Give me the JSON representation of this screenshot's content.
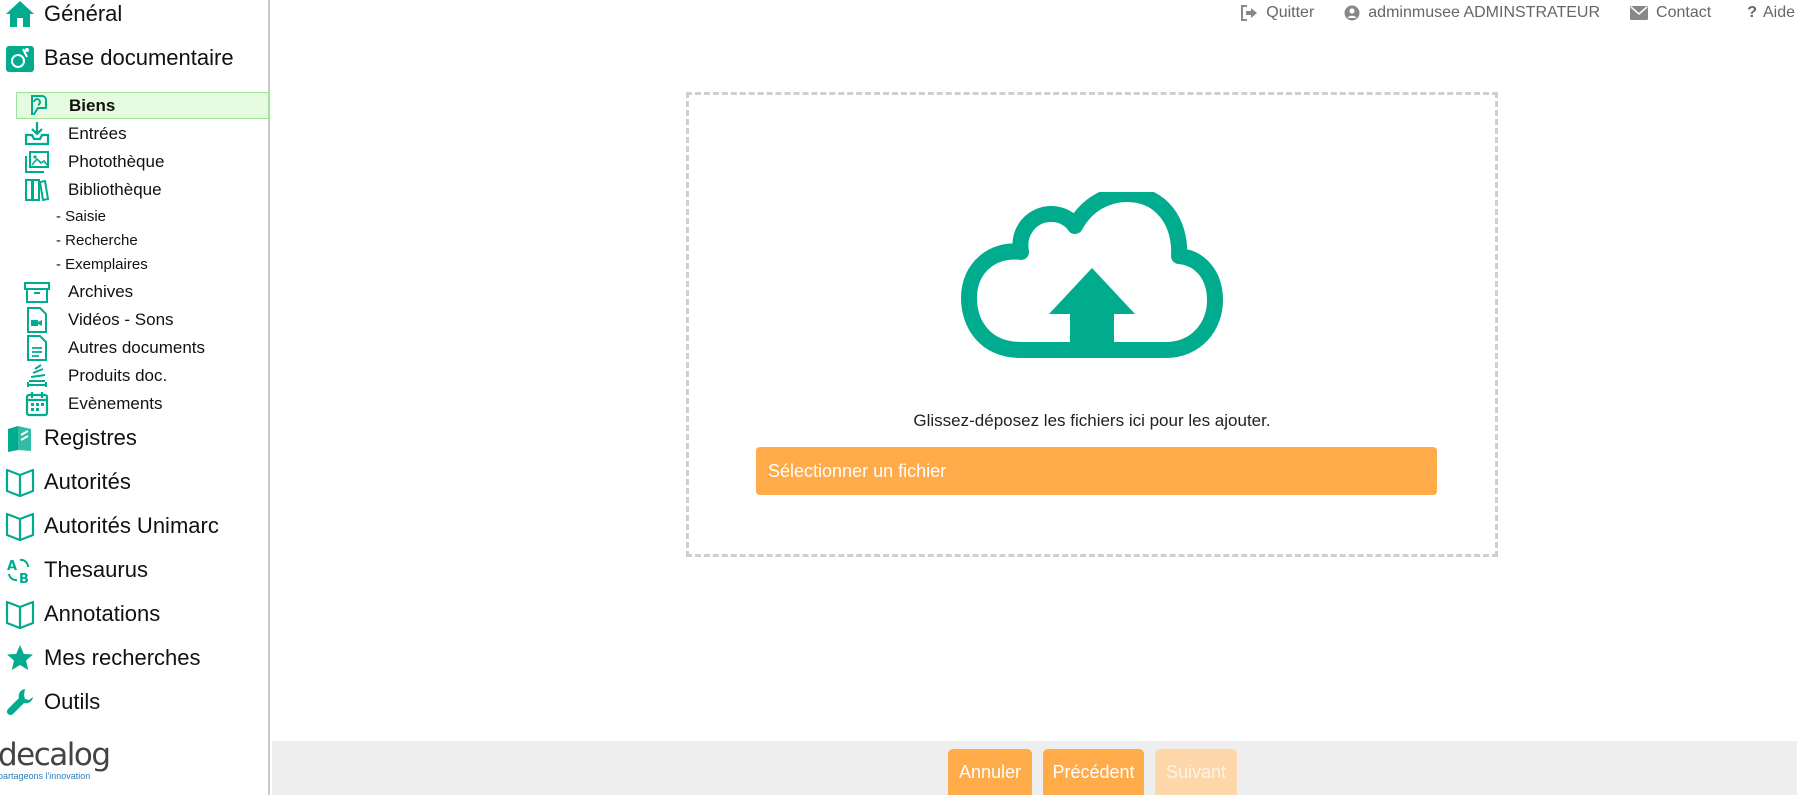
{
  "sidebar": {
    "top_items": [
      {
        "label": "Général",
        "icon": "home-icon"
      },
      {
        "label": "Base documentaire",
        "icon": "documentary-base-icon"
      },
      {
        "label": "Registres",
        "icon": "registers-icon"
      },
      {
        "label": "Autorités",
        "icon": "book-open-icon"
      },
      {
        "label": "Autorités Unimarc",
        "icon": "book-open-icon"
      },
      {
        "label": "Thesaurus",
        "icon": "thesaurus-icon"
      },
      {
        "label": "Annotations",
        "icon": "book-open-icon"
      },
      {
        "label": "Mes recherches",
        "icon": "star-icon"
      },
      {
        "label": "Outils",
        "icon": "wrench-icon"
      }
    ],
    "base_items": [
      {
        "label": "Biens",
        "icon": "property-icon",
        "active": true
      },
      {
        "label": "Entrées",
        "icon": "inbox-download-icon"
      },
      {
        "label": "Photothèque",
        "icon": "photo-library-icon"
      },
      {
        "label": "Bibliothèque",
        "icon": "library-books-icon"
      },
      {
        "label": "Archives",
        "icon": "archive-box-icon"
      },
      {
        "label": "Vidéos - Sons",
        "icon": "video-file-icon"
      },
      {
        "label": "Autres documents",
        "icon": "document-icon"
      },
      {
        "label": "Produits doc.",
        "icon": "stack-icon"
      },
      {
        "label": "Evènements",
        "icon": "calendar-icon"
      }
    ],
    "library_subitems": [
      "- Saisie",
      "- Recherche",
      "- Exemplaires"
    ],
    "logo": {
      "word": "decalog",
      "tagline": "partageons l'innovation"
    }
  },
  "topbar": {
    "quit": "Quitter",
    "user": "adminmusee ADMINSTRATEUR",
    "contact": "Contact",
    "help": "Aide"
  },
  "upload": {
    "drop_text": "Glissez-déposez les fichiers ici pour les ajouter.",
    "select_label": "Sélectionner un fichier"
  },
  "footer": {
    "cancel": "Annuler",
    "previous": "Précédent",
    "next": "Suivant"
  },
  "colors": {
    "accent_teal": "#00ab8e",
    "button_orange": "#ffab4a",
    "button_orange_disabled": "#fdd7a9",
    "active_item_bg": "#e4fbe0"
  }
}
